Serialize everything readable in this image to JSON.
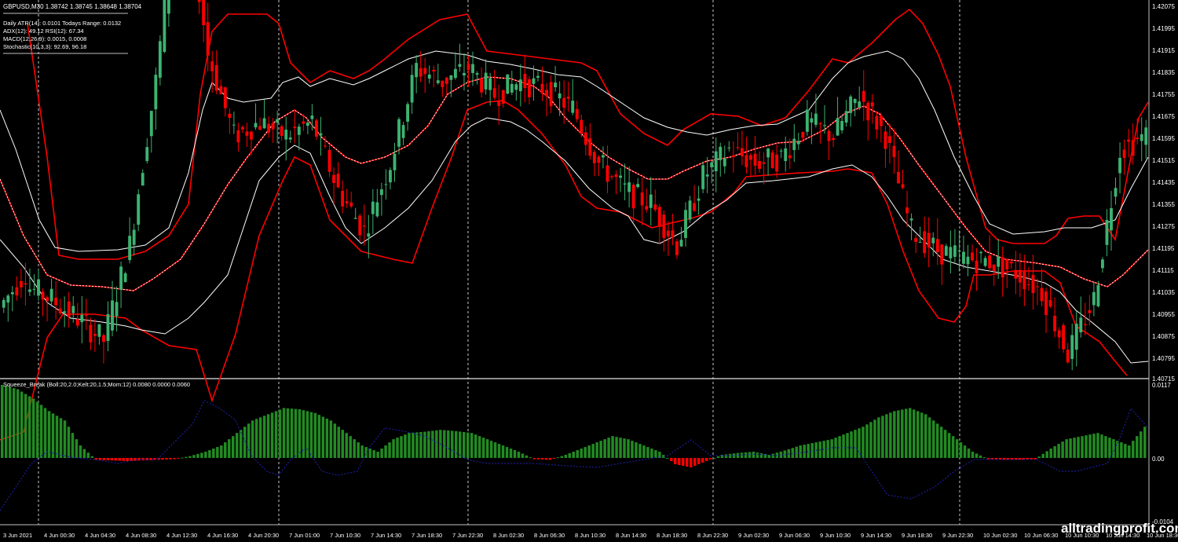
{
  "window": {
    "symbol_line": "GBPUSD,M30  1.38742 1.38745 1.38648 1.38704"
  },
  "info_panel": {
    "lines": [
      "Daily ATR(14): 0.0101 Todays Range: 0.0132",
      "ADX(12): 49.12 RSI(12): 67.34",
      "MACD(12,26,9): 0.0015, 0.0008",
      "Stochastic(10,3,3): 92.69, 96.18"
    ]
  },
  "indicator": {
    "label": "Squeeze_Break (Boll:20,2.0;Kelt:20,1.5;Mom:12) 0.0080 0.0000 0.0060"
  },
  "price_axis": {
    "ticks": [
      "1.42075",
      "1.41995",
      "1.41915",
      "1.41835",
      "1.41755",
      "1.41675",
      "1.41595",
      "1.41515",
      "1.41435",
      "1.41355",
      "1.41275",
      "1.41195",
      "1.41115",
      "1.41035",
      "1.40955",
      "1.40875",
      "1.40795",
      "1.40715"
    ]
  },
  "indicator_axis": {
    "ticks": [
      "0.0117",
      "0.00",
      "-0.0104"
    ]
  },
  "time_axis": {
    "ticks": [
      "3 Jun 2021",
      "4 Jun 00:30",
      "4 Jun 04:30",
      "4 Jun 08:30",
      "4 Jun 12:30",
      "4 Jun 16:30",
      "4 Jun 20:30",
      "7 Jun 01:00",
      "7 Jun 10:30",
      "7 Jun 14:30",
      "7 Jun 18:30",
      "7 Jun 22:30",
      "8 Jun 02:30",
      "8 Jun 06:30",
      "8 Jun 10:30",
      "8 Jun 14:30",
      "8 Jun 18:30",
      "8 Jun 22:30",
      "9 Jun 02:30",
      "9 Jun 06:30",
      "9 Jun 10:30",
      "9 Jun 14:30",
      "9 Jun 18:30",
      "9 Jun 22:30",
      "10 Jun 02:30",
      "10 Jun 06:30",
      "10 Jun 10:30",
      "10 Jun 14:30",
      "10 Jun 18:30"
    ]
  },
  "watermark": "alltradingprofit.com",
  "colors": {
    "background": "#000000",
    "bull_candle": "#3cb371",
    "bear_candle": "#ff0000",
    "bands": "#ff0000",
    "inner_bands": "#ffffff",
    "hist_positive": "#228b22",
    "hist_negative": "#ff0000",
    "signal_line": "#00008b",
    "separator": "#c0c0c0"
  },
  "chart_data": {
    "type": "candlestick",
    "symbol": "GBPUSD",
    "timeframe": "M30",
    "ohlc_last": [
      1.38742,
      1.38745,
      1.38648,
      1.38704
    ],
    "price_range": [
      1.40715,
      1.42075
    ],
    "price_path": [
      [
        1.4097,
        1.411
      ],
      [
        1.4105,
        1.41
      ],
      [
        1.41,
        1.4093
      ],
      [
        1.4093,
        1.4085
      ],
      [
        1.4085,
        1.412
      ],
      [
        1.412,
        1.418
      ],
      [
        1.418,
        1.426
      ],
      [
        1.426,
        1.419
      ],
      [
        1.419,
        1.416
      ],
      [
        1.416,
        1.4165
      ],
      [
        1.4165,
        1.416
      ],
      [
        1.416,
        1.4165
      ],
      [
        1.4165,
        1.414
      ],
      [
        1.414,
        1.4125
      ],
      [
        1.4125,
        1.415
      ],
      [
        1.415,
        1.4185
      ],
      [
        1.4185,
        1.418
      ],
      [
        1.418,
        1.4185
      ],
      [
        1.4185,
        1.4175
      ],
      [
        1.4175,
        1.418
      ],
      [
        1.418,
        1.4177
      ],
      [
        1.4177,
        1.417
      ],
      [
        1.417,
        1.415
      ],
      [
        1.415,
        1.414
      ],
      [
        1.414,
        1.4135
      ],
      [
        1.4135,
        1.412
      ],
      [
        1.412,
        1.4145
      ],
      [
        1.4145,
        1.4155
      ],
      [
        1.4155,
        1.415
      ],
      [
        1.415,
        1.4152
      ],
      [
        1.4152,
        1.4165
      ],
      [
        1.4165,
        1.416
      ],
      [
        1.416,
        1.4175
      ],
      [
        1.4175,
        1.416
      ],
      [
        1.416,
        1.4125
      ],
      [
        1.4125,
        1.4118
      ],
      [
        1.4118,
        1.4115
      ],
      [
        1.4115,
        1.4114
      ],
      [
        1.4114,
        1.411
      ],
      [
        1.411,
        1.4103
      ],
      [
        1.4103,
        1.408
      ],
      [
        1.408,
        1.41
      ],
      [
        1.41,
        1.4155
      ],
      [
        1.4155,
        1.416
      ]
    ],
    "histogram": [
      0.0117,
      0.011,
      0.0095,
      0.0075,
      0.006,
      0.002,
      -0.0003,
      -0.0004,
      -0.0005,
      -0.0004,
      -0.0003,
      -0.0002,
      0.0003,
      0.001,
      0.002,
      0.004,
      0.006,
      0.007,
      0.008,
      0.0078,
      0.0072,
      0.006,
      0.004,
      0.002,
      0.001,
      0.003,
      0.004,
      0.0042,
      0.0045,
      0.0043,
      0.004,
      0.003,
      0.002,
      0.001,
      -0.0002,
      -0.0003,
      0.0005,
      0.0015,
      0.0025,
      0.0035,
      0.003,
      0.002,
      0.001,
      -0.001,
      -0.0015,
      -0.0005,
      0.0005,
      0.0008,
      0.001,
      0.0005,
      0.0012,
      0.002,
      0.0025,
      0.003,
      0.004,
      0.005,
      0.0065,
      0.0075,
      0.008,
      0.007,
      0.005,
      0.003,
      0.001,
      -0.0002,
      -0.0003,
      -0.0003,
      -0.0002,
      0.0015,
      0.003,
      0.0035,
      0.004,
      0.003,
      0.002,
      0.005
    ]
  }
}
